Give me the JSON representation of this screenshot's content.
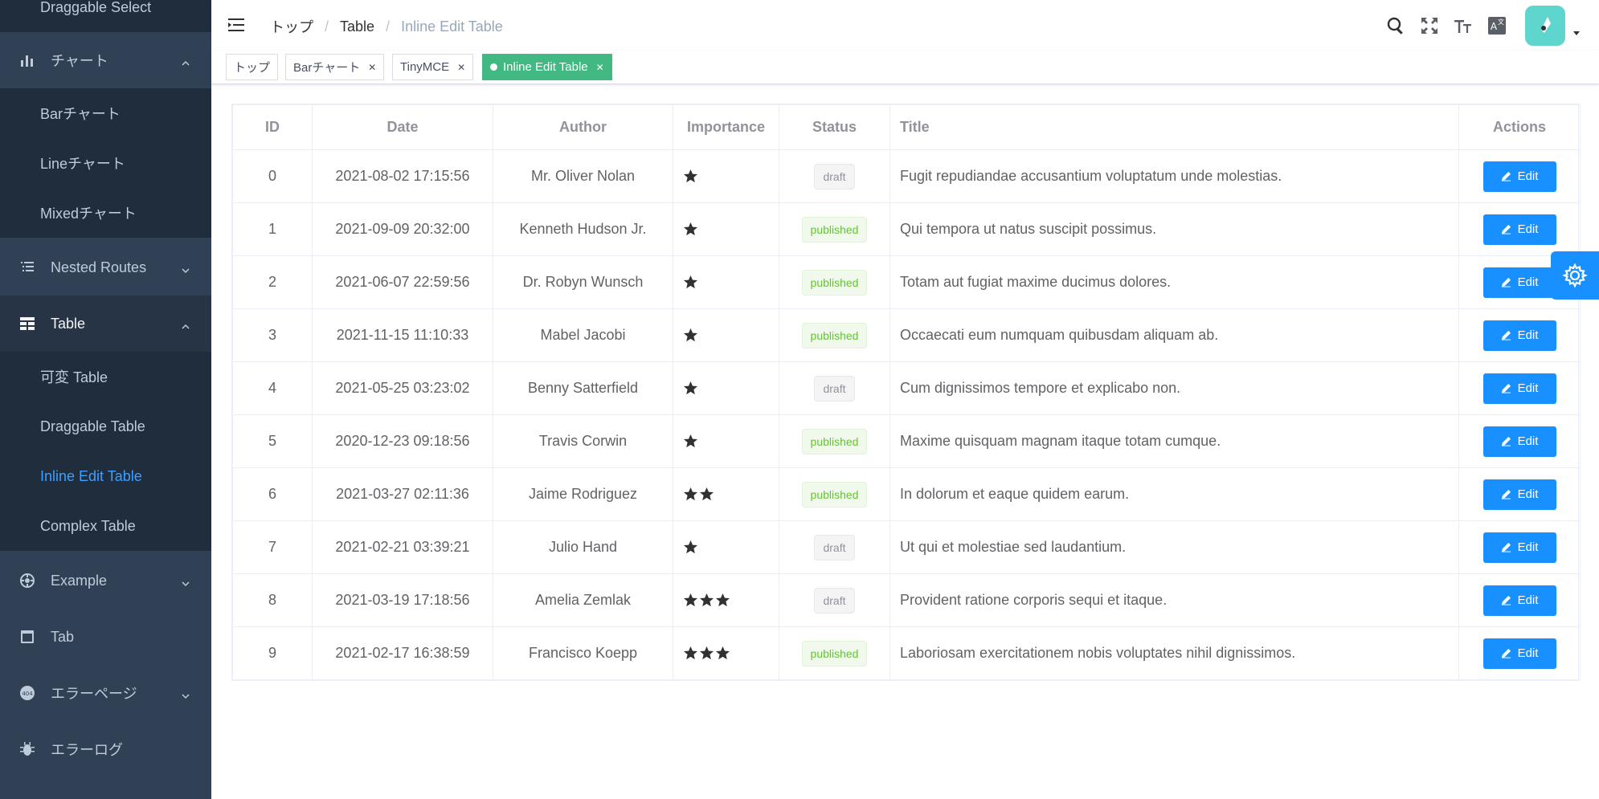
{
  "sidebar": {
    "top_item": "Draggable Select",
    "chart": {
      "label": "チャート",
      "children": [
        "Barチャート",
        "Lineチャート",
        "Mixedチャート"
      ]
    },
    "nested": {
      "label": "Nested Routes"
    },
    "table": {
      "label": "Table",
      "children": [
        "可変 Table",
        "Draggable Table",
        "Inline Edit Table",
        "Complex Table"
      ]
    },
    "example": {
      "label": "Example"
    },
    "tab": {
      "label": "Tab"
    },
    "error_page": {
      "label": "エラーページ"
    },
    "error_log": {
      "label": "エラーログ"
    }
  },
  "breadcrumb": [
    "トップ",
    "Table",
    "Inline Edit Table"
  ],
  "tags": [
    "トップ",
    "Barチャート",
    "TinyMCE",
    "Inline Edit Table"
  ],
  "table": {
    "headers": [
      "ID",
      "Date",
      "Author",
      "Importance",
      "Status",
      "Title",
      "Actions"
    ],
    "edit_label": "Edit",
    "rows": [
      {
        "id": "0",
        "date": "2021-08-02 17:15:56",
        "author": "Mr. Oliver Nolan",
        "importance": 1,
        "status": "draft",
        "title": "Fugit repudiandae accusantium voluptatum unde molestias."
      },
      {
        "id": "1",
        "date": "2021-09-09 20:32:00",
        "author": "Kenneth Hudson Jr.",
        "importance": 1,
        "status": "published",
        "title": "Qui tempora ut natus suscipit possimus."
      },
      {
        "id": "2",
        "date": "2021-06-07 22:59:56",
        "author": "Dr. Robyn Wunsch",
        "importance": 1,
        "status": "published",
        "title": "Totam aut fugiat maxime ducimus dolores."
      },
      {
        "id": "3",
        "date": "2021-11-15 11:10:33",
        "author": "Mabel Jacobi",
        "importance": 1,
        "status": "published",
        "title": "Occaecati eum numquam quibusdam aliquam ab."
      },
      {
        "id": "4",
        "date": "2021-05-25 03:23:02",
        "author": "Benny Satterfield",
        "importance": 1,
        "status": "draft",
        "title": "Cum dignissimos tempore et explicabo non."
      },
      {
        "id": "5",
        "date": "2020-12-23 09:18:56",
        "author": "Travis Corwin",
        "importance": 1,
        "status": "published",
        "title": "Maxime quisquam magnam itaque totam cumque."
      },
      {
        "id": "6",
        "date": "2021-03-27 02:11:36",
        "author": "Jaime Rodriguez",
        "importance": 2,
        "status": "published",
        "title": "In dolorum et eaque quidem earum."
      },
      {
        "id": "7",
        "date": "2021-02-21 03:39:21",
        "author": "Julio Hand",
        "importance": 1,
        "status": "draft",
        "title": "Ut qui et molestiae sed laudantium."
      },
      {
        "id": "8",
        "date": "2021-03-19 17:18:56",
        "author": "Amelia Zemlak",
        "importance": 3,
        "status": "draft",
        "title": "Provident ratione corporis sequi et itaque."
      },
      {
        "id": "9",
        "date": "2021-02-17 16:38:59",
        "author": "Francisco Koepp",
        "importance": 3,
        "status": "published",
        "title": "Laboriosam exercitationem nobis voluptates nihil dignissimos."
      }
    ]
  }
}
